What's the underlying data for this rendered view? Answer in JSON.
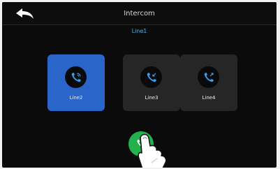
{
  "header": {
    "title": "Intercom",
    "back_icon": "back-arrow-icon"
  },
  "current_line": "Line1",
  "lines": [
    {
      "label": "Line2",
      "icon": "phone-calling-icon",
      "selected": true
    },
    {
      "label": "Line3",
      "icon": "phone-incoming-icon",
      "selected": false
    },
    {
      "label": "Line4",
      "icon": "phone-outgoing-icon",
      "selected": false
    }
  ],
  "call_button": {
    "icon": "phone-icon",
    "color": "#22b14c"
  },
  "colors": {
    "background": "#0b0b0b",
    "tile": "#262626",
    "tile_selected": "#2a66c9",
    "accent_text": "#4fb0e8"
  }
}
